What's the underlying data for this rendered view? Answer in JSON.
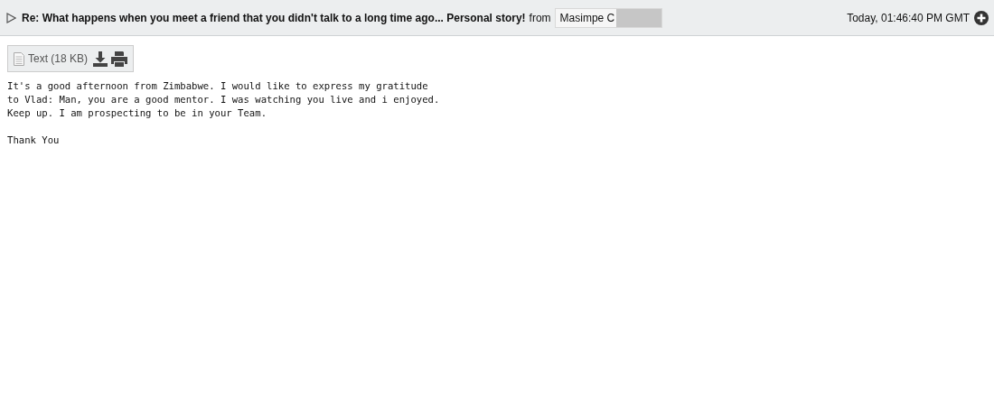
{
  "message": {
    "subject": "Re: What happens when you meet a friend that you didn't talk to a long time ago... Personal story!",
    "from_label": "from",
    "sender": "Masimpe C",
    "time": "Today, 01:46:40 PM GMT"
  },
  "attachment": {
    "label": "Text (18 KB)"
  },
  "body": [
    "It's a good afternoon from Zimbabwe. I would like to express my gratitude\nto Vlad: Man, you are a good mentor. I was watching you live and i enjoyed.\nKeep up. I am prospecting to be in your Team.",
    "Thank You"
  ]
}
